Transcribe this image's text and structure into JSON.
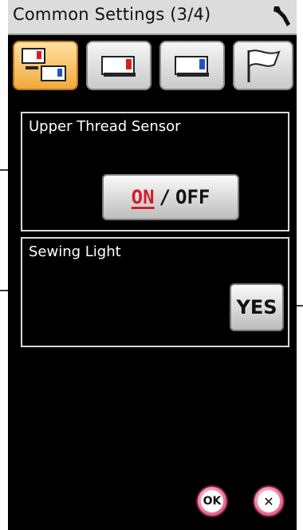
{
  "title": "Common Settings (3/4)",
  "icons": {
    "settings": "wrench-icon",
    "tabs": [
      "machine-settings-icon",
      "straight-stitch-settings-icon",
      "embroidery-settings-icon",
      "language-flag-icon"
    ]
  },
  "panels": {
    "thread_sensor": {
      "label": "Upper Thread Sensor",
      "toggle_on": "ON",
      "toggle_sep": "/",
      "toggle_off": "OFF"
    },
    "sewing_light": {
      "label": "Sewing Light",
      "value": "YES"
    }
  },
  "buttons": {
    "ok": "OK",
    "cancel": "✕"
  },
  "colors": {
    "active_tab": "#f2a93c",
    "on_text": "#d0202a",
    "round_button": "#f07aa0"
  }
}
